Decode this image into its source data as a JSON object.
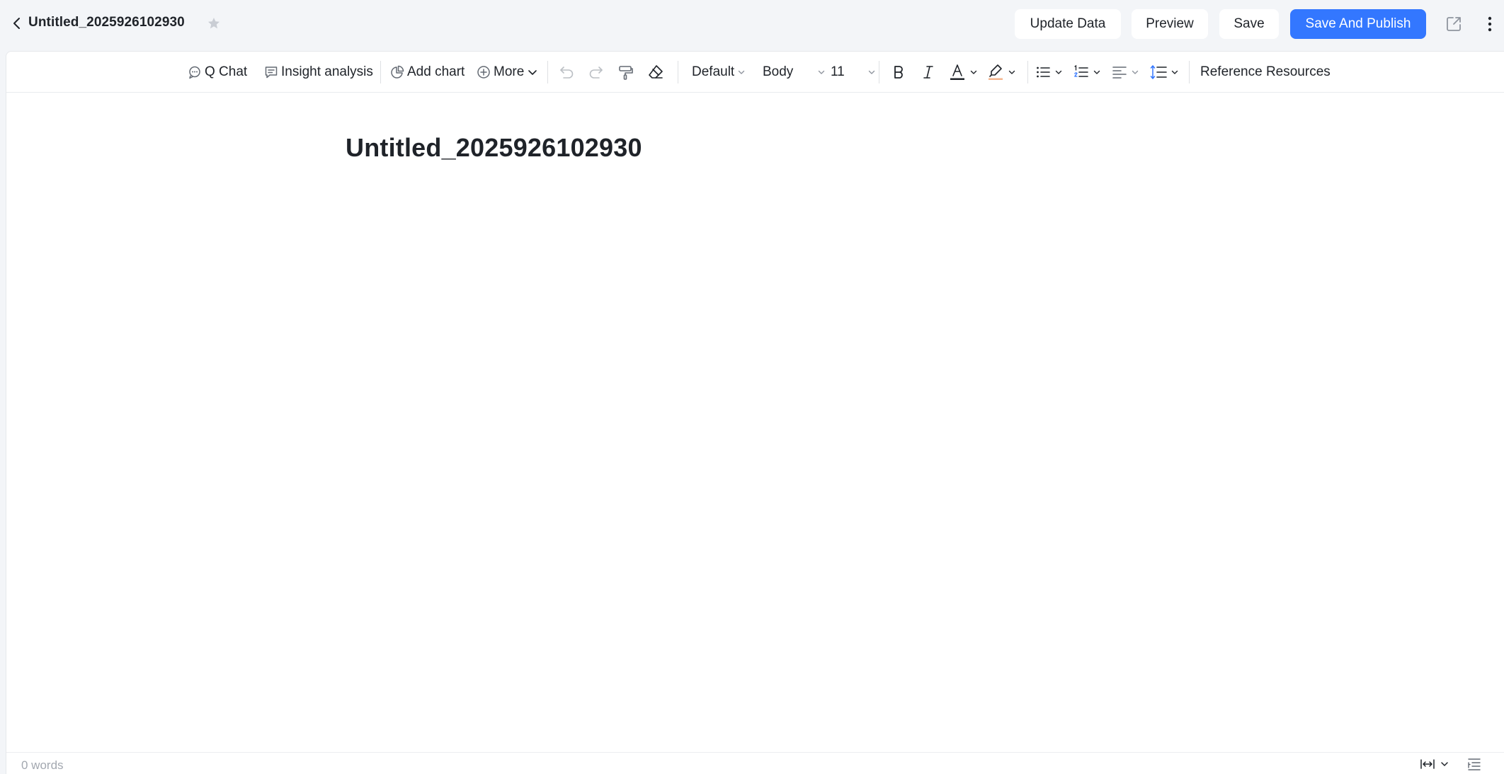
{
  "header": {
    "doc_title": "Untitled_2025926102930",
    "update_data_label": "Update Data",
    "preview_label": "Preview",
    "save_label": "Save",
    "publish_label": "Save And Publish",
    "icons": [
      "back-icon",
      "star-icon",
      "share-icon",
      "more-vertical-icon"
    ]
  },
  "toolbar": {
    "q_chat_label": "Q Chat",
    "insight_label": "Insight analysis",
    "add_chart_label": "Add chart",
    "more_label": "More",
    "font_family": "Default",
    "paragraph_style": "Body",
    "font_size": "11",
    "reference_label": "Reference Resources",
    "icons": [
      "undo-icon",
      "redo-icon",
      "format-painter-icon",
      "eraser-icon",
      "bold-icon",
      "italic-icon",
      "font-color-icon",
      "highlight-icon",
      "bullet-list-icon",
      "numbered-list-icon",
      "align-icon",
      "line-spacing-icon"
    ]
  },
  "document": {
    "heading": "Untitled_2025926102930"
  },
  "status": {
    "word_count": "0 words"
  },
  "colors": {
    "accent": "#3377ff",
    "background": "#f3f5f8",
    "text": "#1f2329",
    "muted": "#a3a8b0"
  }
}
